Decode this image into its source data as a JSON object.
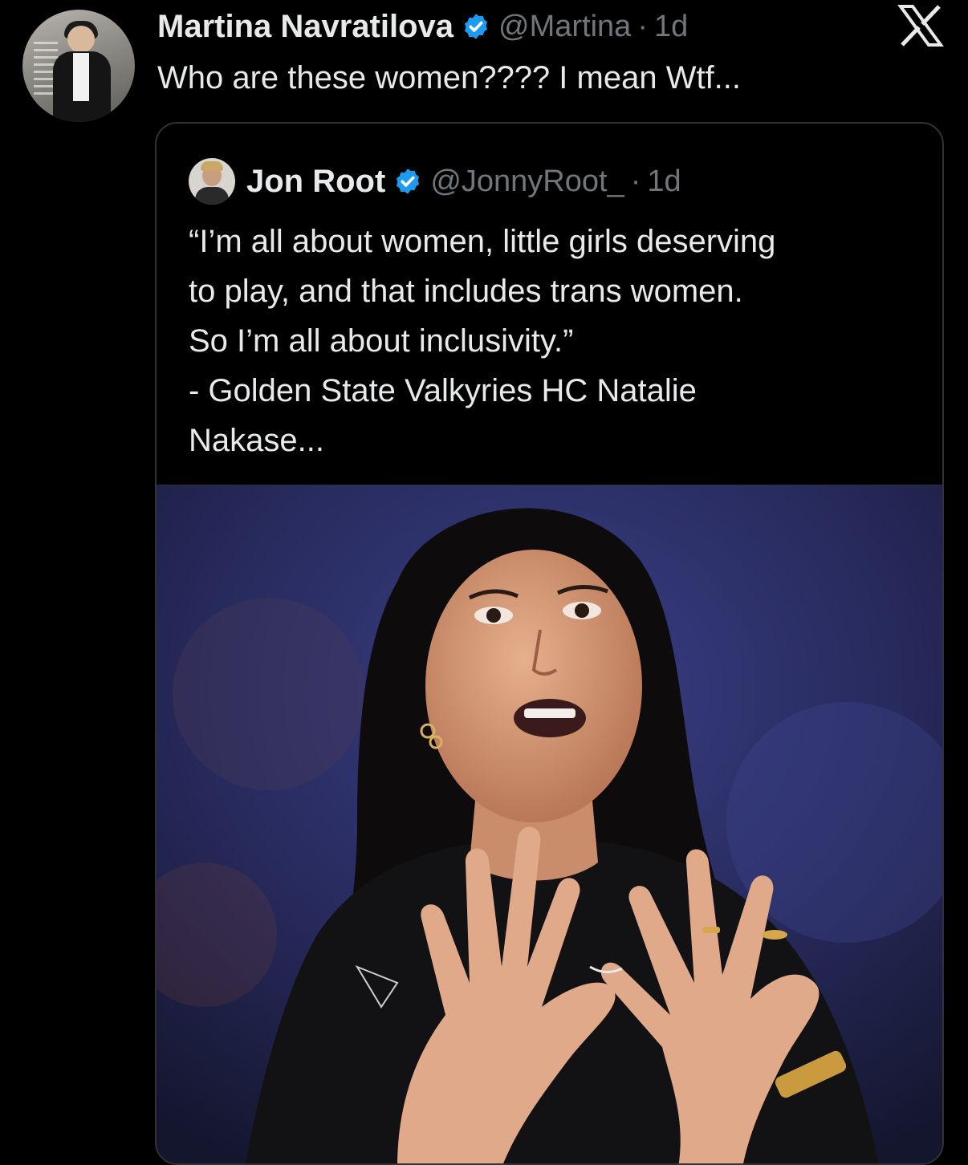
{
  "tweet": {
    "author_name": "Martina Navratilova",
    "handle": "@Martina",
    "separator": "·",
    "time": "1d",
    "text": "Who are these women???? I mean Wtf..."
  },
  "quoted_tweet": {
    "author_name": "Jon Root",
    "handle": "@JonnyRoot_",
    "separator": "·",
    "time": "1d",
    "lines": [
      "“I’m all about women, little girls deserving",
      "to play, and that includes trans women.",
      "So I’m all about inclusivity.”",
      "- Golden State Valkyries HC Natalie",
      "Nakase..."
    ]
  },
  "icons": {
    "verified": "verified-badge-icon",
    "brand": "x-logo-icon"
  },
  "colors": {
    "background": "#000000",
    "text_primary": "#e7e9ea",
    "text_secondary": "#71767b",
    "verified": "#1d9bf0",
    "border": "#2f3336"
  }
}
